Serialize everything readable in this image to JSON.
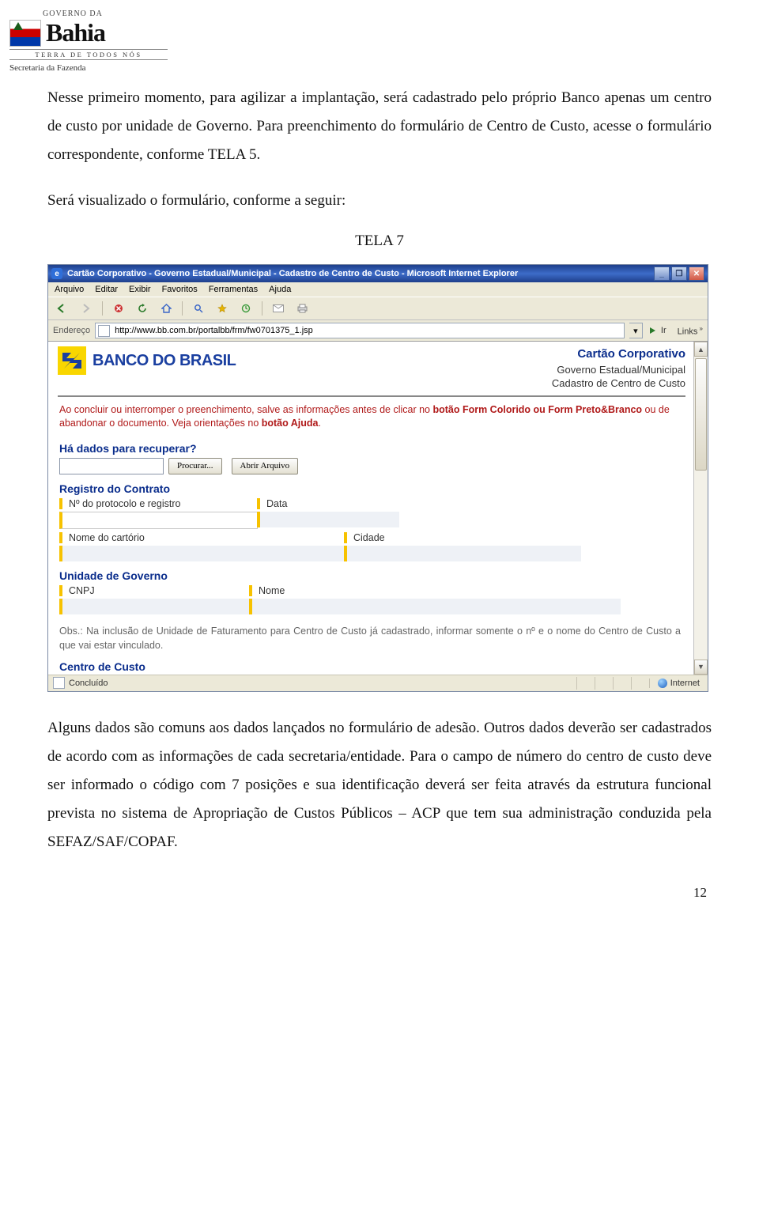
{
  "header": {
    "line1": "GOVERNO DA",
    "word": "Bahia",
    "tagline": "TERRA DE TODOS NÓS",
    "sub_org": "Secretaria da Fazenda"
  },
  "para1": "Nesse primeiro momento, para agilizar a implantação, será cadastrado pelo próprio Banco apenas um centro de custo por unidade de Governo. Para preenchimento do formulário de Centro de Custo, acesse o formulário correspondente, conforme TELA 5.",
  "para2": "Será visualizado o formulário, conforme a seguir:",
  "tela_label": "TELA 7",
  "ie": {
    "title": "Cartão Corporativo - Governo Estadual/Municipal - Cadastro de Centro de Custo - Microsoft Internet Explorer",
    "menu": [
      "Arquivo",
      "Editar",
      "Exibir",
      "Favoritos",
      "Ferramentas",
      "Ajuda"
    ],
    "address_label": "Endereço",
    "address_value": "http://www.bb.com.br/portalbb/frm/fw0701375_1.jsp",
    "go_label": "Ir",
    "links_label": "Links",
    "status_done": "Concluído",
    "status_zone": "Internet"
  },
  "bb": {
    "brand": "BANCO DO BRASIL",
    "meta_title": "Cartão Corporativo",
    "meta_line2": "Governo Estadual/Municipal",
    "meta_line3": "Cadastro de Centro de Custo"
  },
  "warn_plain": "Ao concluir ou interromper o preenchimento, salve as informações antes de clicar no ",
  "warn_b1": "botão Form Colorido ou Form Preto&Branco",
  "warn_tail": " ou de abandonar o documento. Veja orientações no ",
  "warn_b2": "botão Ajuda",
  "warn_dot": ".",
  "recover_title": "Há dados para recuperar?",
  "browse_btn": "Procurar...",
  "open_btn": "Abrir Arquivo",
  "sec_reg": "Registro do Contrato",
  "lbl_protocolo": "Nº do protocolo e registro",
  "lbl_data": "Data",
  "lbl_cartorio": "Nome do cartório",
  "lbl_cidade": "Cidade",
  "sec_unidade": "Unidade de Governo",
  "lbl_cnpj": "CNPJ",
  "lbl_nome": "Nome",
  "obs": "Obs.: Na inclusão de Unidade de Faturamento para Centro de Custo já cadastrado, informar somente o nº e o nome do Centro de Custo a que vai estar vinculado.",
  "sec_centro": "Centro de Custo",
  "para3": "Alguns dados são comuns aos dados lançados no formulário de adesão. Outros dados deverão ser cadastrados de acordo com as informações de cada secretaria/entidade. Para o campo de número do centro de custo deve ser informado o código com 7 posições e sua identificação deverá ser feita através da estrutura funcional prevista no sistema de Apropriação de Custos Públicos – ACP que tem sua administração conduzida pela SEFAZ/SAF/COPAF.",
  "page_number": "12"
}
